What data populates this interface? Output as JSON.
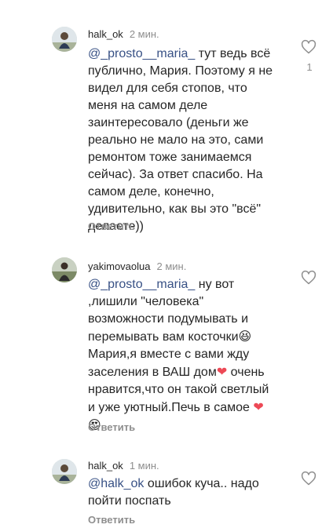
{
  "comments": [
    {
      "username": "halk_ok",
      "time": "2 мин.",
      "mention": "@_prosto__maria_",
      "text": " тут ведь всё публично, Мария. Поэтому я не видел для себя стопов, что меня на самом деле заинтересовало (деньги же реально не мало на это, сами ремонтом тоже занимаемся сейчас). За ответ спасибо. На самом деле, конечно, удивительно, как вы это \"всё\" делаете))",
      "reply_label": "Ответить",
      "like_count": "1",
      "like_icon": "heart-outline-icon"
    },
    {
      "username": "yakimovaolua",
      "time": "2 мин.",
      "mention": "@_prosto__maria_",
      "text_part1": " ну вот ,лишили \"человека\" возможности подумывать и перемывать вам косточки",
      "emoji1": "😆",
      "text_part2": " Мария,я вместе с вами жду заселения в ВАШ дом",
      "emoji2": "❤",
      "text_part3": " очень нравится,что он такой светлый и уже уютный.Печь в самое ",
      "emoji3": "❤",
      "emoji4": "😍",
      "reply_label": "Ответить",
      "like_icon": "heart-outline-icon"
    },
    {
      "username": "halk_ok",
      "time": "1 мин.",
      "mention": "@halk_ok",
      "text": " ошибок куча.. надо пойти поспать",
      "reply_label": "Ответить",
      "like_icon": "heart-outline-icon"
    }
  ],
  "colors": {
    "text": "#262626",
    "secondary": "#8e8e8e",
    "mention": "#385185",
    "heart": "#ed4956"
  }
}
